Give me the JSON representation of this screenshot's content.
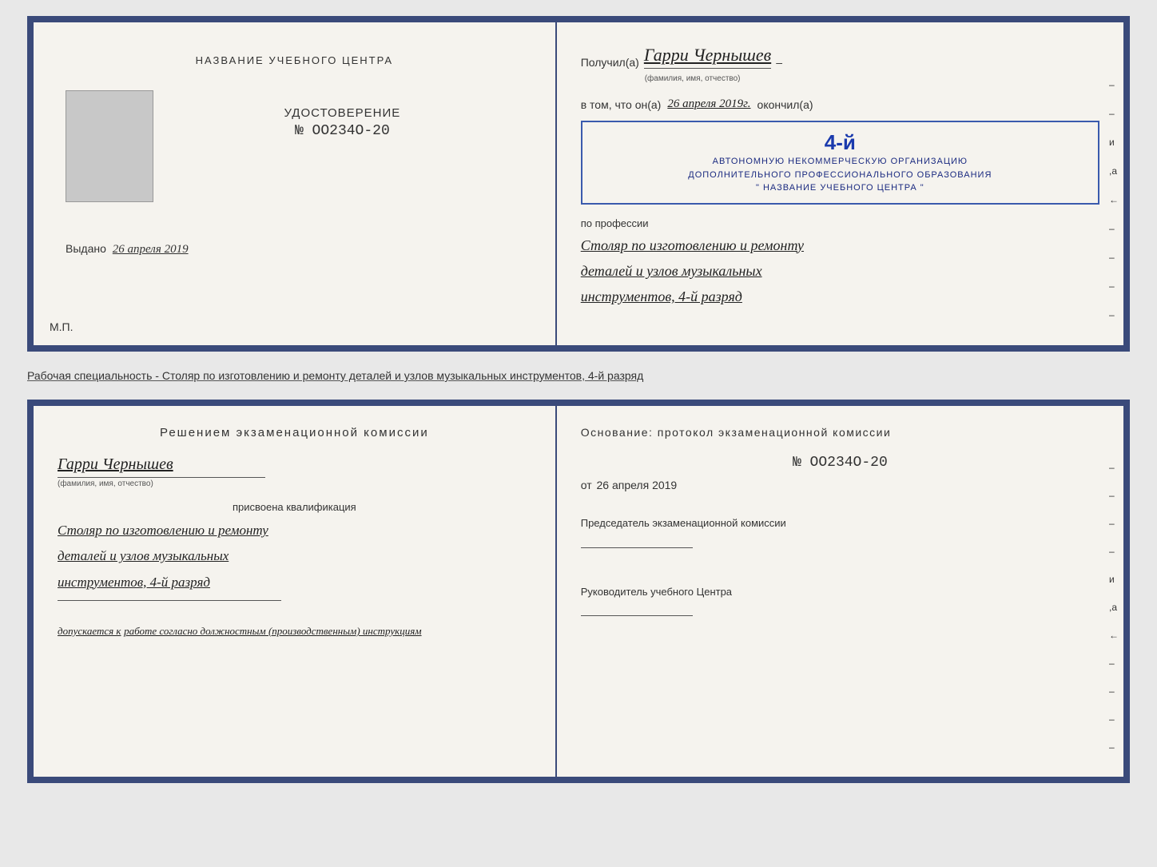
{
  "top_doc": {
    "left": {
      "center_title": "НАЗВАНИЕ УЧЕБНОГО ЦЕНТРА",
      "udostoverenie_label": "УДОСТОВЕРЕНИЕ",
      "doc_number": "№ OO234O-20",
      "vydano": "Выдано",
      "vydano_date": "26 апреля 2019",
      "mp": "М.П."
    },
    "right": {
      "poluchil": "Получил(а)",
      "name": "Гарри Чернышев",
      "fio_note": "(фамилия, имя, отчество)",
      "dash": "–",
      "vtom_chto": "в том, что он(а)",
      "date": "26 апреля 2019г.",
      "okonchil": "окончил(а)",
      "stamp_num": "4-й",
      "stamp_line1": "АВТОНОМНУЮ НЕКОММЕРЧЕСКУЮ ОРГАНИЗАЦИЮ",
      "stamp_line2": "ДОПОЛНИТЕЛЬНОГО ПРОФЕССИОНАЛЬНОГО ОБРАЗОВАНИЯ",
      "stamp_line3": "\" НАЗВАНИЕ УЧЕБНОГО ЦЕНТРА \"",
      "po_professii": "по профессии",
      "profession_line1": "Столяр по изготовлению и ремонту",
      "profession_line2": "деталей и узлов музыкальных",
      "profession_line3": "инструментов, 4-й разряд",
      "right_chars": [
        "–",
        "–",
        "и",
        "а",
        "←",
        "–",
        "–",
        "–",
        "–"
      ]
    }
  },
  "separator": {
    "text": "Рабочая специальность - Столяр по изготовлению и ремонту деталей и узлов музыкальных инструментов, 4-й разряд"
  },
  "bottom_doc": {
    "left": {
      "decision_title": "Решением экзаменационной комиссии",
      "name": "Гарри Чернышев",
      "fio_note": "(фамилия, имя, отчество)",
      "prisvoena": "присвоена квалификация",
      "qual_line1": "Столяр по изготовлению и ремонту",
      "qual_line2": "деталей и узлов музыкальных",
      "qual_line3": "инструментов, 4-й разряд",
      "dopuskaetsya": "допускается к",
      "dopusk_text": "работе согласно должностным (производственным) инструкциям"
    },
    "right": {
      "osnovanie": "Основание: протокол экзаменационной комиссии",
      "protocol_num": "№ OO234O-20",
      "ot": "от",
      "date": "26 апреля 2019",
      "predsedatel": "Председатель экзаменационной комиссии",
      "rukovoditel": "Руководитель учебного Центра",
      "right_chars": [
        "–",
        "–",
        "–",
        "–",
        "и",
        "а",
        "←",
        "–",
        "–",
        "–",
        "–"
      ]
    }
  }
}
